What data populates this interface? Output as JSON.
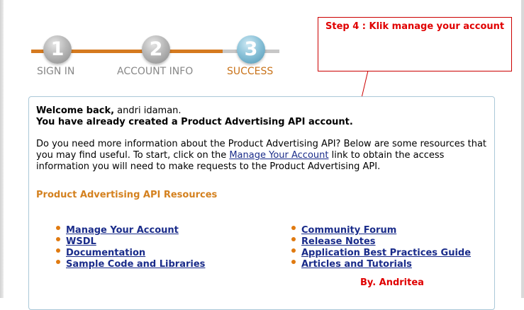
{
  "steps": [
    {
      "number": "1",
      "label": "SIGN IN"
    },
    {
      "number": "2",
      "label": "ACCOUNT INFO"
    },
    {
      "number": "3",
      "label": "SUCCESS"
    }
  ],
  "callout": {
    "text": "Step 4 : Klik manage your account"
  },
  "welcome": {
    "prefix": "Welcome back,",
    "name": " andri idaman.",
    "created": "You have already created a Product Advertising API account."
  },
  "paragraph": {
    "before": "Do you need more information about the Product Advertising API? Below are some resources that you may find useful. To start, click on the ",
    "link": "Manage Your Account",
    "after": " link to obtain the access information you will need to make requests to the Product Advertising API."
  },
  "resources": {
    "title": "Product Advertising API Resources",
    "left": [
      "Manage Your Account",
      "WSDL",
      "Documentation",
      "Sample Code and Libraries"
    ],
    "right": [
      "Community Forum",
      "Release Notes",
      "Application Best Practices Guide",
      "Articles and Tutorials"
    ]
  },
  "byline": "By. Andritea",
  "colors": {
    "accent": "#d4811f",
    "link": "#1a2c8a",
    "annotation": "#e00000",
    "active_step": "#4f95b3"
  }
}
